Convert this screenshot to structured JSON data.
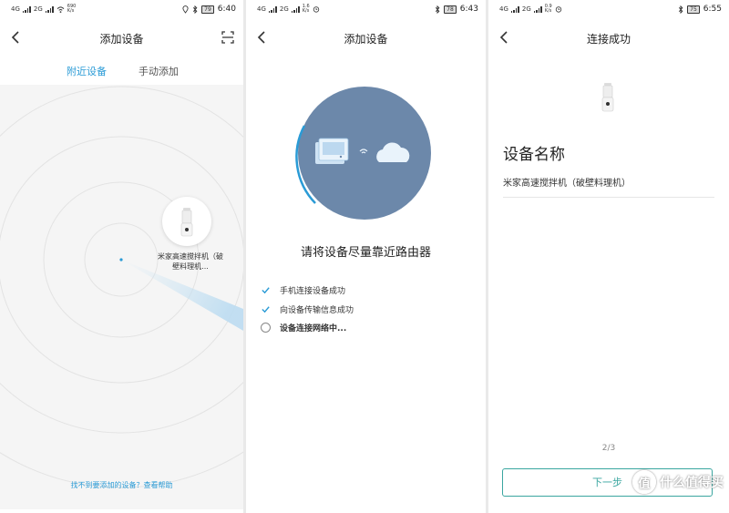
{
  "panel1": {
    "status": {
      "net1": "4G",
      "net2": "2G",
      "speed": "690\nK/s",
      "battery": "79",
      "time": "6:40"
    },
    "title": "添加设备",
    "tabs": [
      {
        "label": "附近设备",
        "active": true
      },
      {
        "label": "手动添加",
        "active": false
      }
    ],
    "device_name": "米家高速搅拌机（破壁料理机...",
    "help_link": "找不到要添加的设备？查看帮助",
    "icons": {
      "back": "chevron-left-icon",
      "scan": "scan-icon"
    }
  },
  "panel2": {
    "status": {
      "net1": "4G",
      "net2": "2G",
      "speed": "1.6\nK/s",
      "battery": "78",
      "time": "6:43"
    },
    "title": "添加设备",
    "message": "请将设备尽量靠近路由器",
    "steps": [
      {
        "label": "手机连接设备成功",
        "state": "done"
      },
      {
        "label": "向设备传输信息成功",
        "state": "done"
      },
      {
        "label": "设备连接网络中...",
        "state": "current"
      }
    ],
    "colors": {
      "circle": "#6c88aa",
      "arc": "#2a9bd6",
      "check": "#2a9bd6"
    }
  },
  "panel3": {
    "status": {
      "net1": "4G",
      "net2": "2G",
      "speed": "0.9\nK/s",
      "battery": "75",
      "time": "6:55"
    },
    "title": "连接成功",
    "name_label": "设备名称",
    "name_value": "米家高速搅拌机（破壁料理机）",
    "pager": "2/3",
    "next_label": "下一步",
    "watermark": "什么值得买",
    "watermark_mark": "值"
  }
}
